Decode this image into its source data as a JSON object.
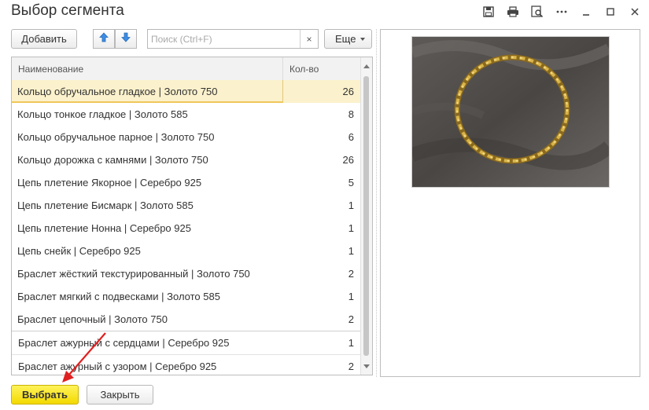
{
  "window": {
    "title": "Выбор сегмента",
    "icons": [
      "save-icon",
      "print-icon",
      "preview-icon",
      "more-icon",
      "minimize-icon",
      "maximize-icon",
      "close-icon"
    ]
  },
  "toolbar": {
    "add_label": "Добавить",
    "search_placeholder": "Поиск (Ctrl+F)",
    "search_value": "",
    "clear_label": "×",
    "more_label": "Еще",
    "accent_color": "#3c8de6"
  },
  "table": {
    "columns": [
      "Наименование",
      "Кол-во"
    ],
    "rows": [
      {
        "name": "Кольцо обручальное гладкое | Золото 750",
        "qty": "26"
      },
      {
        "name": "Кольцо тонкое гладкое | Золото 585",
        "qty": "8"
      },
      {
        "name": "Кольцо обручальное парное | Золото 750",
        "qty": "6"
      },
      {
        "name": "Кольцо дорожка с камнями | Золото 750",
        "qty": "26"
      },
      {
        "name": "Цепь плетение Якорное | Серебро 925",
        "qty": "5"
      },
      {
        "name": "Цепь плетение Бисмарк | Золото 585",
        "qty": "1"
      },
      {
        "name": "Цепь плетение Нонна | Серебро 925",
        "qty": "1"
      },
      {
        "name": "Цепь снейк | Серебро 925",
        "qty": "1"
      },
      {
        "name": "Браслет жёсткий текстурированный | Золото 750",
        "qty": "2"
      },
      {
        "name": "Браслет мягкий с подвесками | Золото 585",
        "qty": "1"
      },
      {
        "name": "Браслет цепочный | Золото 750",
        "qty": "2"
      },
      {
        "name": "Браслет ажурный с сердцами | Серебро 925",
        "qty": "1"
      },
      {
        "name": "Браслет ажурный с узором | Серебро 925",
        "qty": "2"
      }
    ],
    "selected_index": 0,
    "selected_color": "#fbf1cc"
  },
  "footer": {
    "select_label": "Выбрать",
    "close_label": "Закрыть",
    "primary_color": "#f5dc00"
  },
  "annotation": {
    "arrow_color": "#e02020"
  }
}
